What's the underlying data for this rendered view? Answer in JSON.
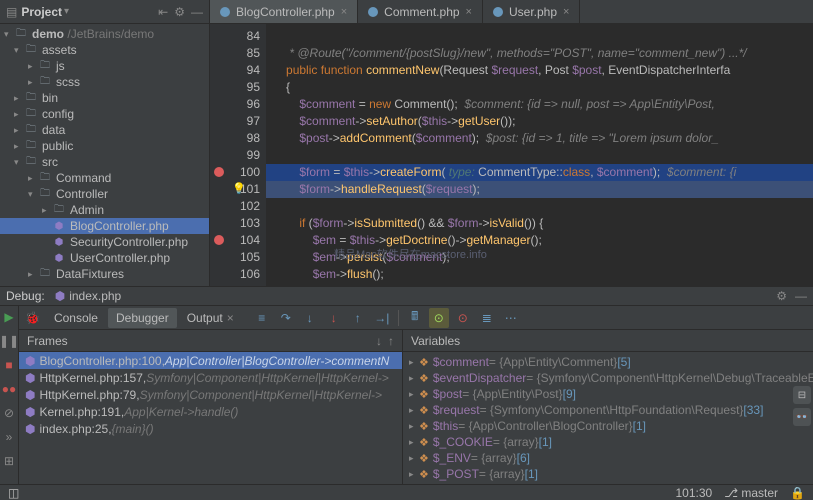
{
  "project": {
    "title": "Project",
    "root": {
      "name": "demo",
      "path": "/JetBrains/demo"
    },
    "tree": [
      {
        "exp": "▾",
        "indent": 0,
        "icon": "folder",
        "label": "assets",
        "type": "dir"
      },
      {
        "exp": "▸",
        "indent": 1,
        "icon": "folder",
        "label": "js",
        "type": "dir"
      },
      {
        "exp": "▸",
        "indent": 1,
        "icon": "folder",
        "label": "scss",
        "type": "dir"
      },
      {
        "exp": "▸",
        "indent": 0,
        "icon": "folder",
        "label": "bin",
        "type": "dir"
      },
      {
        "exp": "▸",
        "indent": 0,
        "icon": "folder",
        "label": "config",
        "type": "dir"
      },
      {
        "exp": "▸",
        "indent": 0,
        "icon": "folder",
        "label": "data",
        "type": "dir"
      },
      {
        "exp": "▸",
        "indent": 0,
        "icon": "folder",
        "label": "public",
        "type": "dir"
      },
      {
        "exp": "▾",
        "indent": 0,
        "icon": "folder",
        "label": "src",
        "type": "dir"
      },
      {
        "exp": "▸",
        "indent": 1,
        "icon": "folder",
        "label": "Command",
        "type": "dir"
      },
      {
        "exp": "▾",
        "indent": 1,
        "icon": "folder",
        "label": "Controller",
        "type": "dir"
      },
      {
        "exp": "▸",
        "indent": 2,
        "icon": "folder",
        "label": "Admin",
        "type": "dir"
      },
      {
        "exp": "",
        "indent": 2,
        "icon": "php",
        "label": "BlogController.php",
        "type": "file",
        "sel": true
      },
      {
        "exp": "",
        "indent": 2,
        "icon": "php",
        "label": "SecurityController.php",
        "type": "file"
      },
      {
        "exp": "",
        "indent": 2,
        "icon": "php",
        "label": "UserController.php",
        "type": "file"
      },
      {
        "exp": "▸",
        "indent": 1,
        "icon": "folder",
        "label": "DataFixtures",
        "type": "dir"
      }
    ]
  },
  "tabs": [
    {
      "label": "BlogController.php",
      "active": true
    },
    {
      "label": "Comment.php",
      "active": false
    },
    {
      "label": "User.php",
      "active": false
    }
  ],
  "editor": {
    "lines": [
      84,
      85,
      94,
      95,
      96,
      97,
      98,
      99,
      100,
      101,
      102,
      103,
      104,
      105,
      106
    ],
    "breakpoints": [
      100,
      104
    ],
    "bulb_line": 101,
    "highlight_lines": [
      100,
      101
    ],
    "code_rows": [
      {
        "html": ""
      },
      {
        "html": "    <span class='cm'>* @Route(\"/comment/{postSlug}/new\", methods=\"POST\", name=\"comment_new\") ...*/</span>"
      },
      {
        "html": "   <span class='kw'>public function</span> <span class='fn'>commentNew</span>(Request <span class='var'>$request</span>, Post <span class='var'>$post</span>, EventDispatcherInterfa"
      },
      {
        "html": "   {"
      },
      {
        "html": "       <span class='var'>$comment</span> = <span class='kw'>new</span> Comment();  <span class='cm'>$comment: {id =&gt; null, post =&gt; App\\Entity\\Post,</span>"
      },
      {
        "html": "       <span class='var'>$comment</span>-&gt;<span class='fn'>setAuthor</span>(<span class='var'>$this</span>-&gt;<span class='fn'>getUser</span>());"
      },
      {
        "html": "       <span class='var'>$post</span>-&gt;<span class='fn'>addComment</span>(<span class='var'>$comment</span>);  <span class='cm'>$post: {id =&gt; 1, title =&gt; \"Lorem ipsum dolor_</span>"
      },
      {
        "html": ""
      },
      {
        "html": "       <span class='var'>$form</span> = <span class='var'>$this</span>-&gt;<span class='fn'>createForm</span>( <span class='ty'>type:</span> CommentType::<span class='kw'>class</span>, <span class='var'>$comment</span>);  <span class='cm'>$comment: {i</span>"
      },
      {
        "html": "       <span class='var'>$form</span>-&gt;<span class='fn'>handleRequest</span>(<span class='var'>$request</span>);"
      },
      {
        "html": ""
      },
      {
        "html": "       <span class='kw'>if</span> (<span class='var'>$form</span>-&gt;<span class='fn'>isSubmitted</span>() &amp;&amp; <span class='var'>$form</span>-&gt;<span class='fn'>isValid</span>()) {"
      },
      {
        "html": "           <span class='var'>$em</span> = <span class='var'>$this</span>-&gt;<span class='fn'>getDoctrine</span>()-&gt;<span class='fn'>getManager</span>();"
      },
      {
        "html": "           <span class='var'>$em</span>-&gt;<span class='fn'>persist</span>(<span class='var'>$comment</span>);"
      },
      {
        "html": "           <span class='var'>$em</span>-&gt;<span class='fn'>flush</span>();"
      }
    ]
  },
  "debug": {
    "title": "Debug:",
    "run_config": "index.php",
    "tabs": {
      "console": "Console",
      "debugger": "Debugger",
      "output": "Output"
    },
    "frames_title": "Frames",
    "variables_title": "Variables",
    "frames": [
      {
        "file": "BlogController.php:100",
        "ctx": "App|Controller|BlogController->commentN",
        "sel": true
      },
      {
        "file": "HttpKernel.php:157",
        "ctx": "Symfony|Component|HttpKernel|HttpKernel->"
      },
      {
        "file": "HttpKernel.php:79",
        "ctx": "Symfony|Component|HttpKernel|HttpKernel->"
      },
      {
        "file": "Kernel.php:191",
        "ctx": "App|Kernel->handle()"
      },
      {
        "file": "index.php:25",
        "ctx": "{main}()"
      }
    ],
    "variables": [
      {
        "name": "$comment",
        "val": " = {App\\Entity\\Comment} ",
        "num": "[5]"
      },
      {
        "name": "$eventDispatcher",
        "val": " = {Symfony\\Component\\HttpKernel\\Debug\\TraceableEven"
      },
      {
        "name": "$post",
        "val": " = {App\\Entity\\Post} ",
        "num": "[9]"
      },
      {
        "name": "$request",
        "val": " = {Symfony\\Component\\HttpFoundation\\Request} ",
        "num": "[33]"
      },
      {
        "name": "$this",
        "val": " = {App\\Controller\\BlogController} ",
        "num": "[1]"
      },
      {
        "name": "$_COOKIE",
        "val": " = {array} ",
        "num": "[1]"
      },
      {
        "name": "$_ENV",
        "val": " = {array} ",
        "num": "[6]"
      },
      {
        "name": "$_POST",
        "val": " = {array} ",
        "num": "[1]"
      }
    ]
  },
  "statusbar": {
    "pos": "101:30",
    "branch": "master"
  },
  "watermark": "精品Mac软件尽在macstore.info"
}
